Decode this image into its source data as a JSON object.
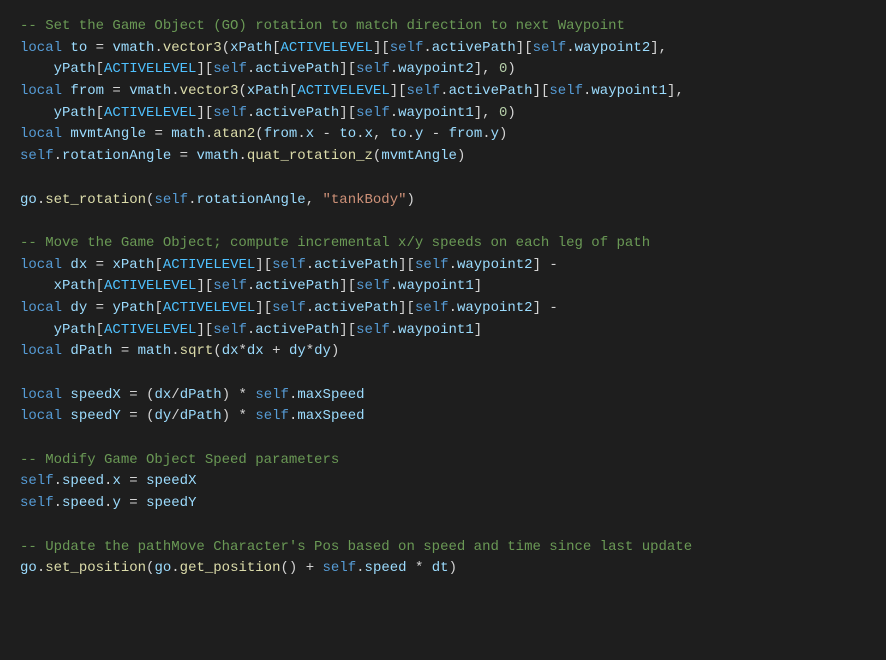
{
  "code": {
    "c1": "-- Set the Game Object (GO) rotation to match direction to next Waypoint",
    "kw_local": "local",
    "to": "to",
    "from": "from",
    "eq": " = ",
    "vmath": "vmath",
    "dot": ".",
    "vector3": "vector3",
    "lpar": "(",
    "rpar": ")",
    "xPath": "xPath",
    "yPath": "yPath",
    "lbr": "[",
    "rbr": "]",
    "ACTIVELEVEL": "ACTIVELEVEL",
    "self": "self",
    "activePath": "activePath",
    "waypoint1": "waypoint1",
    "waypoint2": "waypoint2",
    "comma": ",",
    "sp": " ",
    "zero": "0",
    "indent": "    ",
    "mvmtAngle": "mvmtAngle",
    "math": "math",
    "atan2": "atan2",
    "x": "x",
    "y": "y",
    "minus": " - ",
    "rotationAngle": "rotationAngle",
    "quat_rotation_z": "quat_rotation_z",
    "go": "go",
    "set_rotation": "set_rotation",
    "tankBody": "\"tankBody\"",
    "c2": "-- Move the Game Object; compute incremental x/y speeds on each leg of path",
    "dx": "dx",
    "dy": "dy",
    "dPath": "dPath",
    "sqrt": "sqrt",
    "star": "*",
    "plus": " + ",
    "speedX": "speedX",
    "speedY": "speedY",
    "slash": "/",
    "starsp": " * ",
    "maxSpeed": "maxSpeed",
    "c3": "-- Modify Game Object Speed parameters",
    "speed": "speed",
    "c4": "-- Update the pathMove Character's Pos based on speed and time since last update",
    "set_position": "set_position",
    "get_position": "get_position",
    "dt": "dt"
  }
}
